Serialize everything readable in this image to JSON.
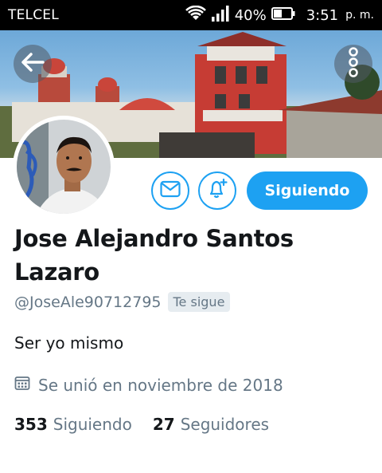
{
  "status_bar": {
    "carrier": "TELCEL",
    "battery_percent": "40%",
    "time": "3:51",
    "ampm": "p. m."
  },
  "header": {
    "back_icon": "arrow-left-icon",
    "more_icon": "more-vertical-icon"
  },
  "actions": {
    "message_icon": "mail-icon",
    "notify_icon": "bell-plus-icon",
    "follow_label": "Siguiendo"
  },
  "profile": {
    "name": "Jose Alejandro Santos Lazaro",
    "handle": "@JoseAle90712795",
    "follows_you_label": "Te sigue",
    "bio": "Ser yo mismo",
    "joined": "Se unió en noviembre de 2018",
    "following_count": "353",
    "following_label": "Siguiendo",
    "followers_count": "27",
    "followers_label": "Seguidores"
  },
  "colors": {
    "accent": "#1da1f2",
    "secondary_text": "#657786",
    "chip_bg": "#e6ecf0"
  }
}
